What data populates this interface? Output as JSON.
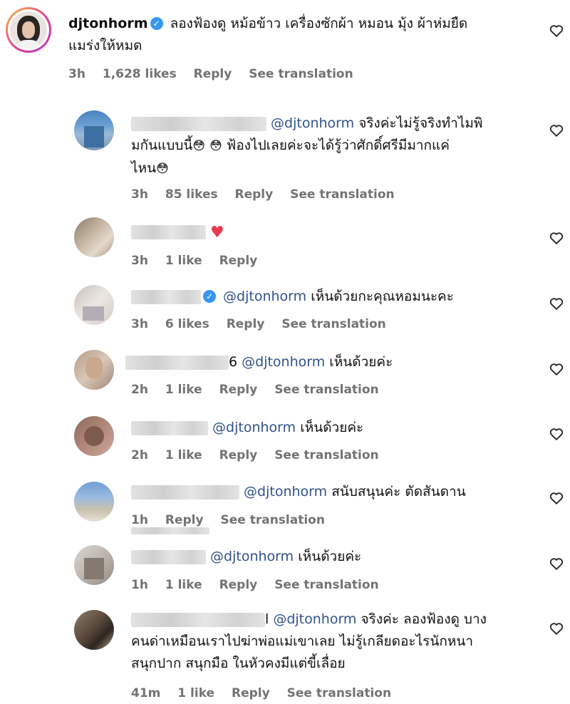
{
  "main": {
    "username": "djtonhorm",
    "caption_line1": "ลองฟ้องดู หม้อข้าว เครื่องซักผ้า หมอน มุ้ง ผ้าห่มยืด",
    "caption_line2": "แมร่งให้หมด",
    "time": "3h",
    "likes": "1,628 likes",
    "reply": "Reply",
    "see_translation": "See translation"
  },
  "replies": [
    {
      "mention": "@djtonhorm",
      "line1": " จริงค่ะไม่รู้จริงทำไมพิ",
      "line2": "มกันแบบนี้",
      "line2b": " ฟ้องไปเลยค่ะจะได้รู้ว่าศักดิ์ศรีมีมากแค่",
      "line3": "ไหน",
      "time": "3h",
      "likes": "85 likes",
      "reply": "Reply",
      "see_translation": "See translation"
    },
    {
      "time": "3h",
      "likes": "1 like",
      "reply": "Reply"
    },
    {
      "mention": "@djtonhorm",
      "line1": " เห็นด้วยกะคุณหอมนะคะ",
      "time": "3h",
      "likes": "6 likes",
      "reply": "Reply",
      "see_translation": "See translation"
    },
    {
      "prefix": "6",
      "mention": "@djtonhorm",
      "line1": " เห็นด้วยค่ะ",
      "time": "2h",
      "likes": "1 like",
      "reply": "Reply",
      "see_translation": "See translation"
    },
    {
      "mention": "@djtonhorm",
      "line1": " เห็นด้วยค่ะ",
      "time": "2h",
      "likes": "1 like",
      "reply": "Reply",
      "see_translation": "See translation"
    },
    {
      "mention": "@djtonhorm",
      "line1": " สนับสนุนค่ะ ตัดสันดาน",
      "time": "1h",
      "reply": "Reply",
      "see_translation": "See translation"
    },
    {
      "mention": "@djtonhorm",
      "line1": " เห็นด้วยค่ะ",
      "time": "1h",
      "likes": "1 like",
      "reply": "Reply",
      "see_translation": "See translation"
    },
    {
      "prefix": "l",
      "mention": "@djtonhorm",
      "line1": " จริงค่ะ ลองฟ้องดู บาง",
      "line2": "คนด่าเหมือนเราไปฆ่าพ่อแม่เขาเลย ไม่รู้เกลียดอะไรนักหนา",
      "line3": "สนุกปาก สนุกมือ ในหัวคงมีแต่ขี้เลื่อย",
      "time": "41m",
      "likes": "1 like",
      "reply": "Reply",
      "see_translation": "See translation"
    }
  ],
  "icons": {
    "heart": "heart-outline-icon",
    "verified": "verified-badge-icon",
    "emoji": "flushed-face-emoji",
    "red_heart": "red-heart-emoji"
  },
  "colors": {
    "mention": "#33528a",
    "meta": "#737373",
    "verified": "#3897f0",
    "red_heart": "#e8384f"
  }
}
